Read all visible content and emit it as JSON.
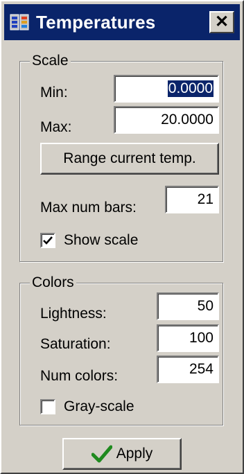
{
  "window": {
    "title": "Temperatures",
    "close_glyph": "✕",
    "icon": "app-icon"
  },
  "scale": {
    "group_label": "Scale",
    "min_label": "Min:",
    "min_value": "0.0000",
    "max_label": "Max:",
    "max_value": "20.0000",
    "range_button": "Range current temp.",
    "max_bars_label": "Max num bars:",
    "max_bars_value": "21",
    "show_scale_label": "Show scale",
    "show_scale_checked": true
  },
  "colors": {
    "group_label": "Colors",
    "lightness_label": "Lightness:",
    "lightness_value": "50",
    "saturation_label": "Saturation:",
    "saturation_value": "100",
    "num_colors_label": "Num colors:",
    "num_colors_value": "254",
    "gray_scale_label": "Gray-scale",
    "gray_scale_checked": false
  },
  "apply": {
    "label": "Apply",
    "icon": "checkmark-icon",
    "icon_color": "#1f8a1f"
  },
  "theme": {
    "titlebar": "#0a246a",
    "face": "#d4d0c8",
    "selection": "#0a246a"
  }
}
